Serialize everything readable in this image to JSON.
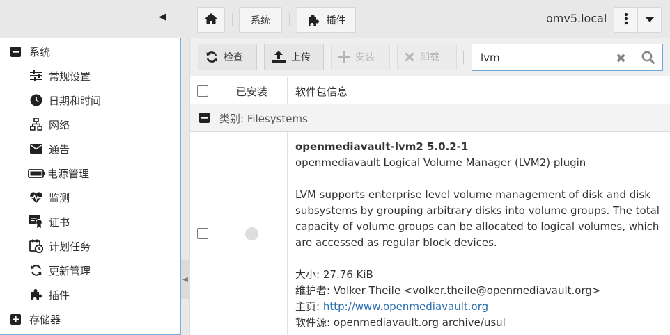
{
  "topbar": {
    "home_icon": "home-icon",
    "breadcrumb_system": "系统",
    "breadcrumb_plugins": "插件",
    "hostname": "omv5.local"
  },
  "sidebar": {
    "items": [
      {
        "label": "系统",
        "icon": "minus-square-icon",
        "level": "top"
      },
      {
        "label": "常规设置",
        "icon": "sliders-icon",
        "level": "sub"
      },
      {
        "label": "日期和时间",
        "icon": "clock-icon",
        "level": "sub"
      },
      {
        "label": "网络",
        "icon": "sitemap-icon",
        "level": "sub"
      },
      {
        "label": "通告",
        "icon": "envelope-icon",
        "level": "sub"
      },
      {
        "label": "电源管理",
        "icon": "battery-icon",
        "level": "sub"
      },
      {
        "label": "监测",
        "icon": "heartbeat-icon",
        "level": "sub"
      },
      {
        "label": "证书",
        "icon": "certificate-icon",
        "level": "sub"
      },
      {
        "label": "计划任务",
        "icon": "calendar-clock-icon",
        "level": "sub"
      },
      {
        "label": "更新管理",
        "icon": "refresh-icon",
        "level": "sub"
      },
      {
        "label": "插件",
        "icon": "puzzle-icon",
        "level": "sub"
      },
      {
        "label": "存储器",
        "icon": "plus-square-icon",
        "level": "top"
      }
    ]
  },
  "toolbar": {
    "check_label": "检查",
    "upload_label": "上传",
    "install_label": "安装",
    "uninstall_label": "卸载"
  },
  "search": {
    "value": "lvm"
  },
  "table": {
    "col_installed": "已安装",
    "col_info": "软件包信息",
    "group_label": "类别: Filesystems",
    "row": {
      "name": "openmediavault-lvm2 5.0.2-1",
      "summary": "openmediavault Logical Volume Manager (LVM2) plugin",
      "description": "LVM supports enterprise level volume management of disk and disk subsystems by grouping arbitrary disks into volume groups. The total capacity of volume groups can be allocated to logical volumes, which are accessed as regular block devices.",
      "size_label": "大小: ",
      "size_value": "27.76 KiB",
      "maintainer_label": "维护者: ",
      "maintainer_value": "Volker Theile <volker.theile@openmediavault.org>",
      "homepage_label": "主页: ",
      "homepage_value": "http://www.openmediavault.org",
      "repo_label": "软件源: ",
      "repo_value": "openmediavault.org archive/usul"
    }
  },
  "colors": {
    "accent": "#6fa6d6",
    "link": "#2a6fb0"
  }
}
